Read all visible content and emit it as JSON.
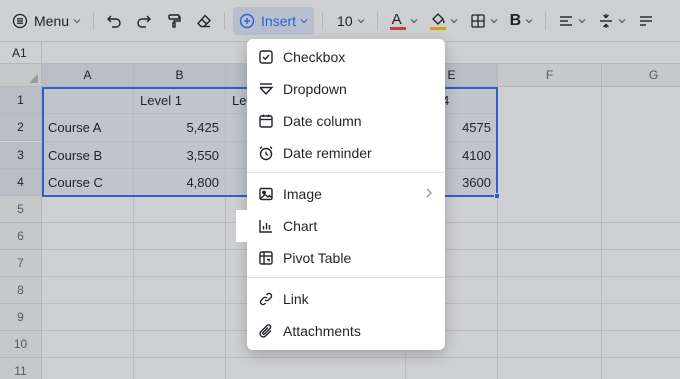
{
  "toolbar": {
    "menu_label": "Menu",
    "insert_label": "Insert",
    "font_size": "10",
    "bold_label": "B",
    "text_color_label": "A",
    "accent_color": "#3370ff"
  },
  "name_box": "A1",
  "grid": {
    "columns": [
      "A",
      "B",
      "C",
      "D",
      "E",
      "F",
      "G"
    ],
    "rows": [
      "1",
      "2",
      "3",
      "4",
      "5",
      "6",
      "7",
      "8",
      "9",
      "10",
      "11"
    ],
    "cells": {
      "B1": "Level 1",
      "C1": "Lev",
      "E1": "4",
      "A2": "Course A",
      "B2": "5,425",
      "E2": "4575",
      "A3": "Course B",
      "B3": "3,550",
      "E3": "4100",
      "A4": "Course C",
      "B4": "4,800",
      "E4": "3600"
    }
  },
  "insert_menu": {
    "items": [
      {
        "label": "Checkbox",
        "icon": "checkbox-icon"
      },
      {
        "label": "Dropdown",
        "icon": "dropdown-icon"
      },
      {
        "label": "Date column",
        "icon": "calendar-icon"
      },
      {
        "label": "Date reminder",
        "icon": "alarm-clock-icon"
      },
      {
        "label": "Image",
        "icon": "image-icon",
        "submenu": true
      },
      {
        "label": "Chart",
        "icon": "bar-chart-icon",
        "highlighted": true
      },
      {
        "label": "Pivot Table",
        "icon": "pivot-table-icon"
      },
      {
        "label": "Link",
        "icon": "link-icon"
      },
      {
        "label": "Attachments",
        "icon": "paperclip-icon"
      }
    ]
  }
}
